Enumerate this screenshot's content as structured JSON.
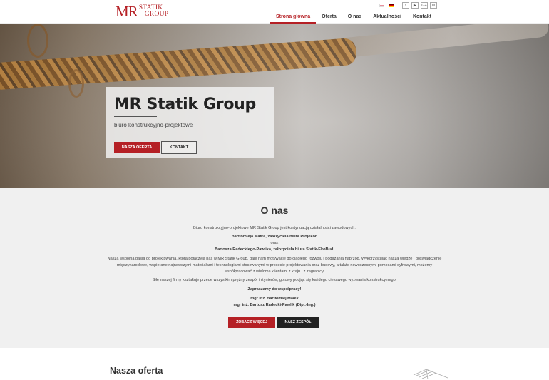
{
  "header": {
    "logo": {
      "mr": "MR",
      "line1": "STATIK",
      "line2": "GROUP"
    },
    "languages": [
      {
        "code": "pl",
        "icon": "flag-poland-icon"
      },
      {
        "code": "de",
        "icon": "flag-germany-icon"
      }
    ],
    "social": [
      {
        "glyph": "f",
        "icon": "facebook-icon"
      },
      {
        "glyph": "▶",
        "icon": "youtube-icon"
      },
      {
        "glyph": "G+",
        "icon": "google-plus-icon"
      },
      {
        "glyph": "✉",
        "icon": "email-icon"
      }
    ],
    "nav": [
      {
        "label": "Strona główna",
        "active": true
      },
      {
        "label": "Oferta",
        "active": false
      },
      {
        "label": "O nas",
        "active": false
      },
      {
        "label": "Aktualności",
        "active": false
      },
      {
        "label": "Kontakt",
        "active": false
      }
    ]
  },
  "hero": {
    "title": "MR Statik Group",
    "subtitle": "biuro konstrukcyjno-projektowe",
    "primary_button": "NASZA OFERTA",
    "secondary_button": "KONTAKT"
  },
  "about": {
    "title": "O nas",
    "intro": "Biuro konstrukcyjno-projektowe MR Statik Group jest kontynuacją działalności zawodowych:",
    "founder1": "Bartłomieja Małka, założyciela biura Projekon",
    "and": "oraz",
    "founder2": "Bartosza Radeckiego-Pawlika, założyciela biura Statik-EkoBud.",
    "para1": "Nasza wspólna pasja do projektowania, która połączyła nas w MR Statik Group, daje nam motywację do ciągłego rozwoju i podążania naprzód. Wykorzystując naszą wiedzę i doświadczenie międzynarodowe, wspierane najnowszymi materiałami i technologiami stosowanymi w procesie projektowania oraz budowy, a także nowoczesnymi pomocami cyfrowymi, możemy współpracować z wieloma klientami z kraju i z zagranicy.",
    "para2": "Siłę naszej firmy kształtuje przede wszystkim prężny zespół inżynierów, gotowy podjąć się każdego ciekawego wyzwania konstrukcyjnego.",
    "invite": "Zapraszamy do współpracy!",
    "person1": "mgr inż. Bartłomiej Małek",
    "person2": "mgr inż. Bartosz Radecki-Pawlik (Dipl.-Ing.)",
    "more_button": "ZOBACZ WIĘCEJ",
    "team_button": "NASZ ZESPÓŁ"
  },
  "offer": {
    "title": "Nasza oferta"
  },
  "colors": {
    "accent": "#b52025",
    "dark": "#222222",
    "section_bg": "#f0f0f0"
  }
}
